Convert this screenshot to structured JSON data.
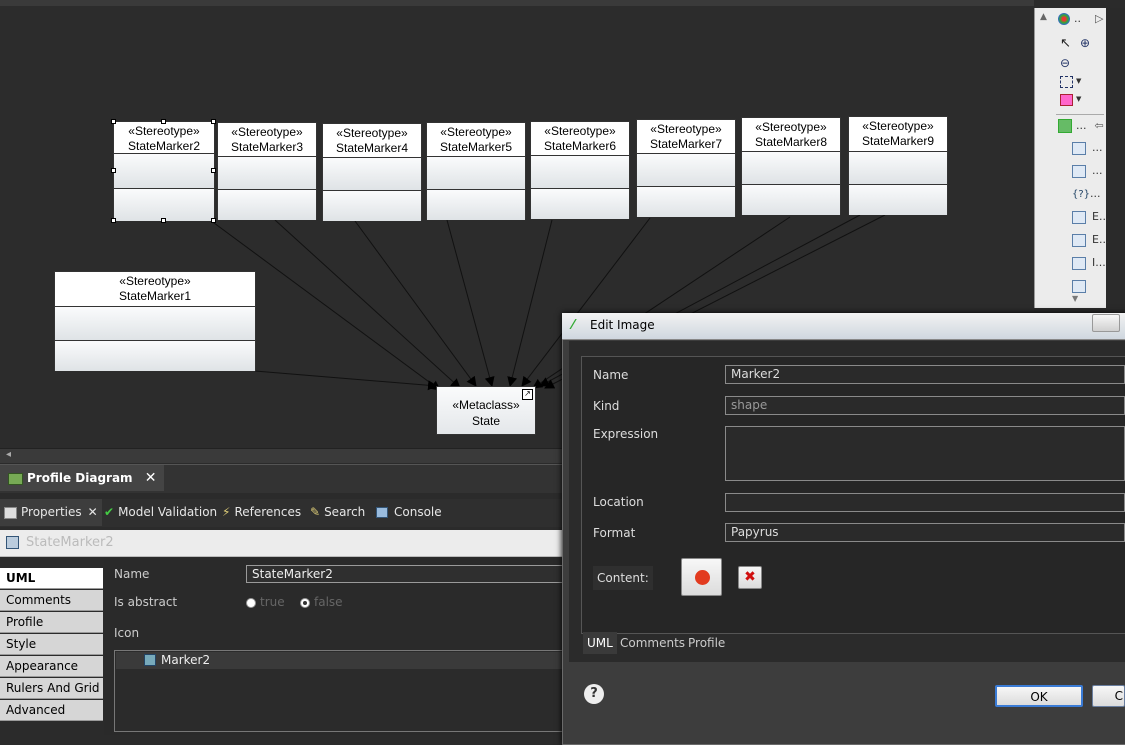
{
  "diagram": {
    "stereotypes": [
      {
        "keyword": "«Stereotype»",
        "name": "StateMarker2"
      },
      {
        "keyword": "«Stereotype»",
        "name": "StateMarker3"
      },
      {
        "keyword": "«Stereotype»",
        "name": "StateMarker4"
      },
      {
        "keyword": "«Stereotype»",
        "name": "StateMarker5"
      },
      {
        "keyword": "«Stereotype»",
        "name": "StateMarker6"
      },
      {
        "keyword": "«Stereotype»",
        "name": "StateMarker7"
      },
      {
        "keyword": "«Stereotype»",
        "name": "StateMarker8"
      },
      {
        "keyword": "«Stereotype»",
        "name": "StateMarker9"
      },
      {
        "keyword": "«Stereotype»",
        "name": "StateMarker1"
      }
    ],
    "metaclass": {
      "keyword": "«Metaclass»",
      "name": "State"
    }
  },
  "palette": {
    "items": [
      "..",
      "...",
      "...",
      "...",
      "...",
      "E...",
      "E...",
      "I..."
    ]
  },
  "editor_tab": {
    "label": "Profile Diagram"
  },
  "views": {
    "tabs": [
      "Properties",
      "Model Validation",
      "References",
      "Search",
      "Console"
    ],
    "title": "StateMarker2"
  },
  "properties": {
    "side_tabs": [
      "UML",
      "Comments",
      "Profile",
      "Style",
      "Appearance",
      "Rulers And Grid",
      "Advanced"
    ],
    "name_label": "Name",
    "name_value": "StateMarker2",
    "abstract_label": "Is abstract",
    "abstract_true": "true",
    "abstract_false": "false",
    "icon_label": "Icon",
    "icon_item": "Marker2"
  },
  "dialog": {
    "title": "Edit Image",
    "name_label": "Name",
    "name_value": "Marker2",
    "kind_label": "Kind",
    "kind_value": "shape",
    "expression_label": "Expression",
    "location_label": "Location",
    "format_label": "Format",
    "format_value": "Papyrus",
    "content_label": "Content:",
    "tabs": [
      "UML",
      "Comments",
      "Profile"
    ],
    "ok_label": "OK",
    "cancel_label": "C"
  },
  "colors": {
    "content_dot": "#e23b1f",
    "delete_x": "#d01010"
  }
}
